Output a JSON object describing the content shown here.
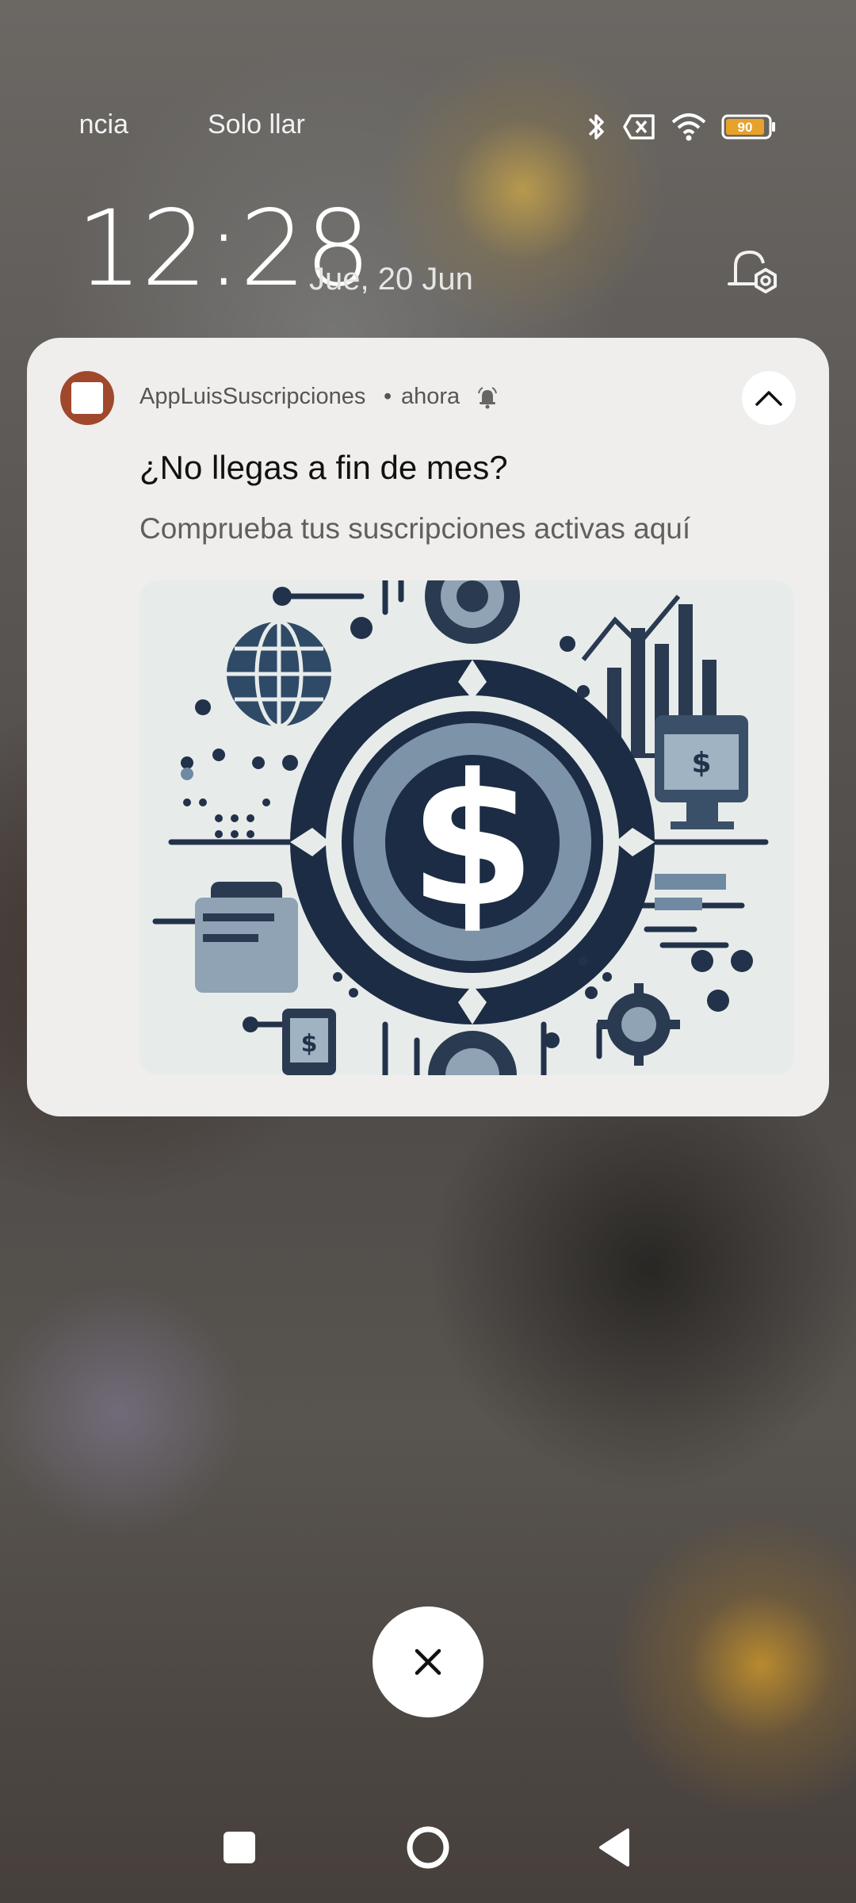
{
  "status_bar": {
    "marquee_left": "ncia",
    "marquee_right": "Solo llar",
    "battery_level": "90",
    "icons": [
      "bluetooth-icon",
      "no-sim-icon",
      "wifi-icon",
      "battery-icon"
    ]
  },
  "lockscreen": {
    "time": "12:28",
    "date": "Jue, 20 Jun"
  },
  "notification": {
    "app_name": "AppLuisSuscripciones",
    "separator": "•",
    "time": "ahora",
    "title": "¿No llegas a fin de mes?",
    "body": "Comprueba tus suscripciones activas aquí",
    "app_icon_color": "#a0482c"
  },
  "nav": {
    "buttons": [
      "recents",
      "home",
      "back"
    ]
  }
}
